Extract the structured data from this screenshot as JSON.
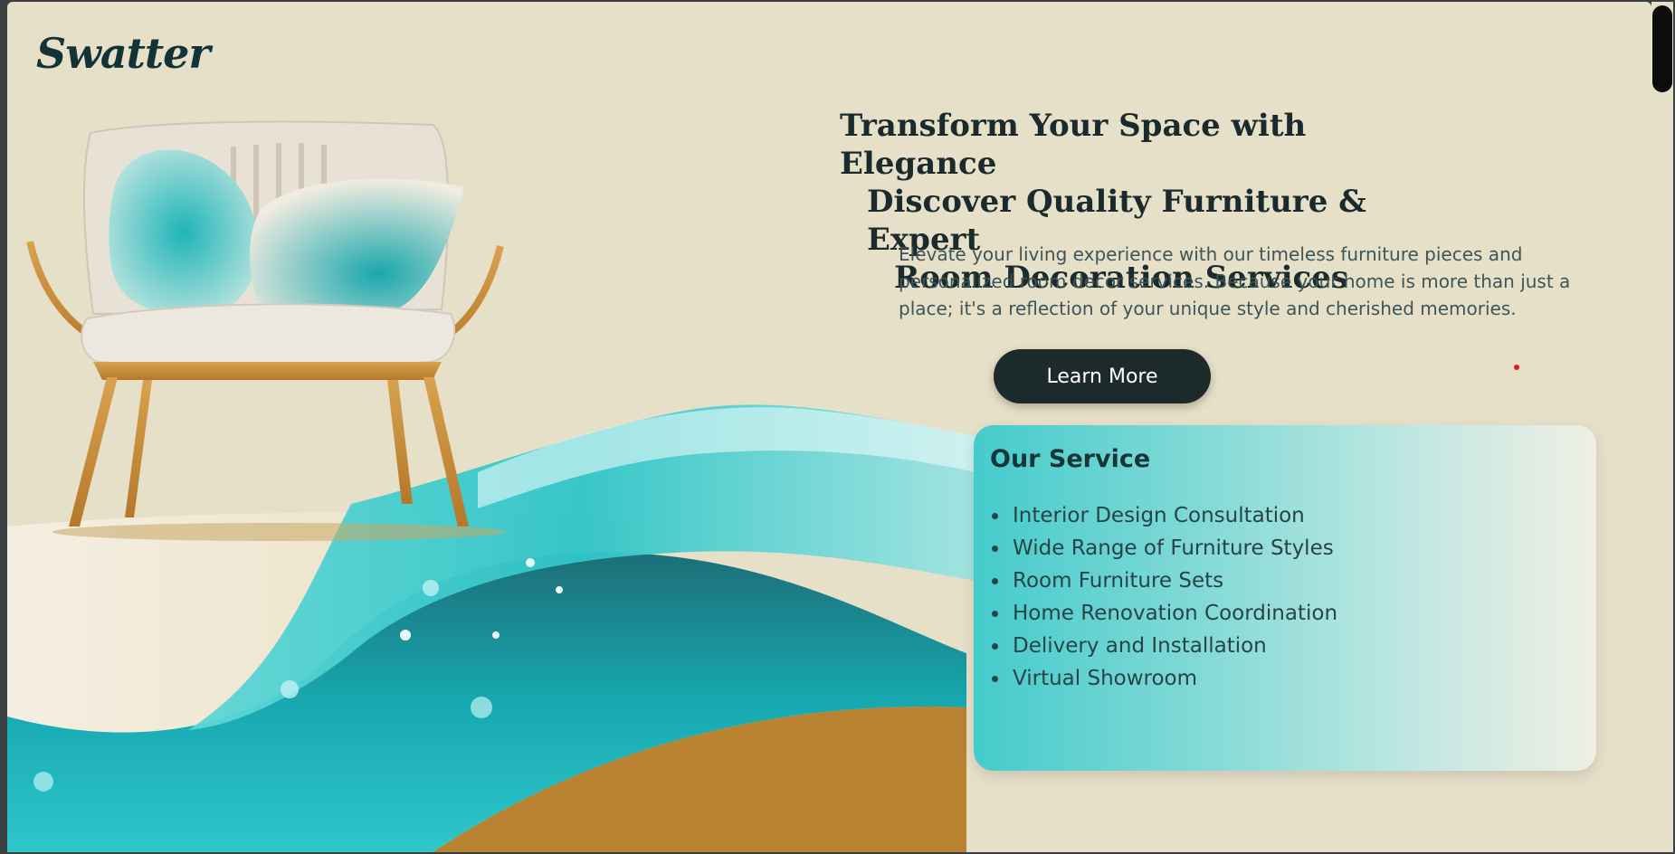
{
  "brand": {
    "logo_text": "Swatter"
  },
  "hero": {
    "headline_lines": [
      "Transform Your Space with Elegance",
      "Discover Quality Furniture & Expert",
      "Room Decoration Services"
    ],
    "intro": "Elevate your living experience with our timeless furniture pieces and personalized room decor services. Because your home is more than just a place; it's a reflection of your unique style and cherished memories.",
    "cta_label": "Learn More",
    "image_description": "armchair-with-teal-water-wave"
  },
  "services": {
    "title": "Our Service",
    "items": [
      "Interior Design Consultation",
      "Wide Range of Furniture Styles",
      "Room Furniture Sets",
      "Home Renovation Coordination",
      "Delivery and Installation",
      "Virtual Showroom"
    ]
  },
  "colors": {
    "page_bg": "#e7e0c9",
    "brand_dark": "#1c2a2c",
    "teal": "#45cbcc",
    "text_muted": "#3e5558"
  }
}
